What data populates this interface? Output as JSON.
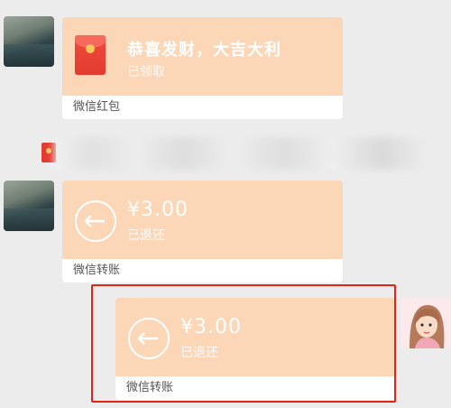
{
  "messages": [
    {
      "type": "red_packet",
      "title": "恭喜发财，大吉大利",
      "status": "已领取",
      "footer": "微信红包"
    },
    {
      "type": "transfer",
      "amount": "¥3.00",
      "status": "已退还",
      "footer": "微信转账"
    },
    {
      "type": "transfer",
      "amount": "¥3.00",
      "status": "已退还",
      "footer": "微信转账"
    }
  ],
  "colors": {
    "bubble": "#fbd7b8",
    "background": "#ececec",
    "highlight_border": "#e2231a",
    "red_packet": "#e23b2f"
  }
}
